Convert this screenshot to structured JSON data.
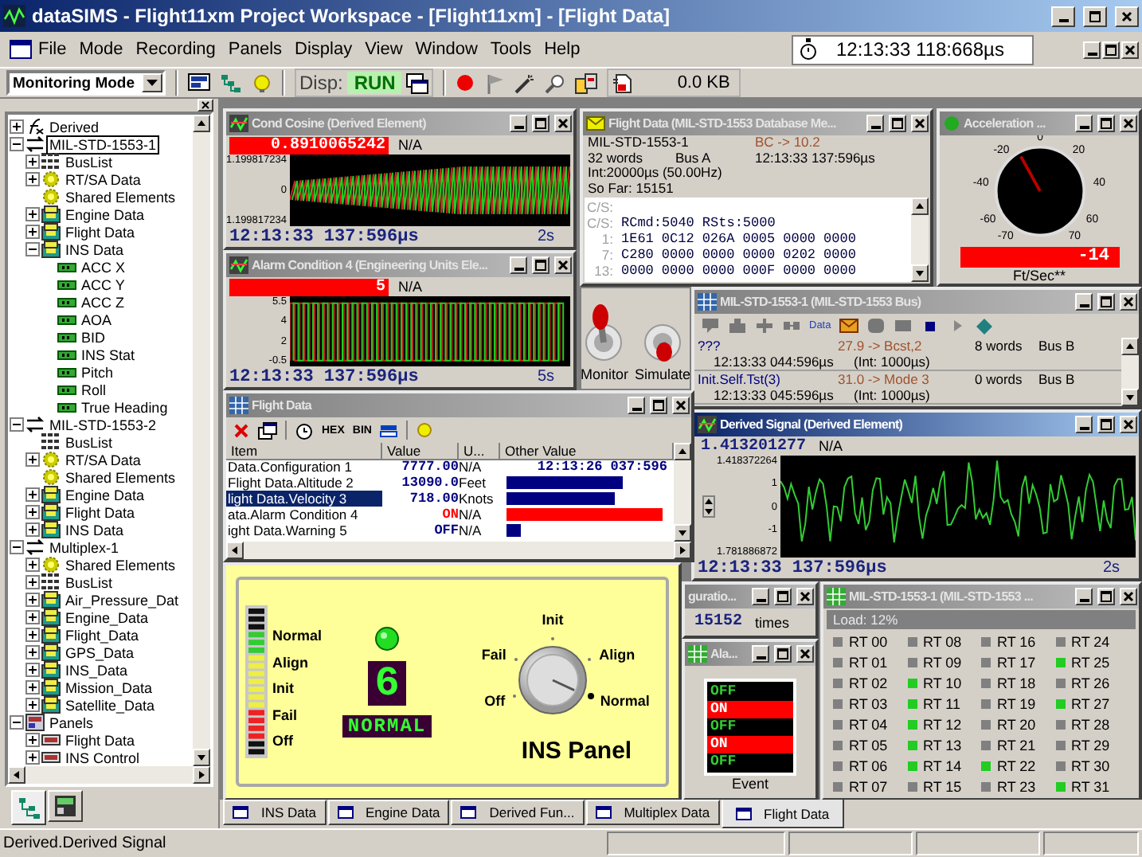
{
  "window": {
    "title": "dataSIMS - Flight11xm Project Workspace - [Flight11xm] - [Flight Data]"
  },
  "menu": [
    "File",
    "Mode",
    "Recording",
    "Panels",
    "Display",
    "View",
    "Window",
    "Tools",
    "Help"
  ],
  "clock": "12:13:33 118:668µs",
  "toolbar": {
    "mode": "Monitoring Mode",
    "disp_label": "Disp:",
    "run": "RUN",
    "size": "0.0 KB"
  },
  "tree": {
    "items": [
      {
        "label": "Derived",
        "kind": "derived",
        "expanded": false,
        "selected": false
      },
      {
        "label": "MIL-STD-1553-1",
        "kind": "bus",
        "expanded": true,
        "selected": true,
        "children": [
          {
            "label": "BusList",
            "kind": "buslist",
            "expanded": false,
            "selected": false
          },
          {
            "label": "RT/SA Data",
            "kind": "rtsa",
            "expanded": false,
            "selected": false
          },
          {
            "label": "Shared Elements",
            "kind": "rtsa",
            "selected": false
          },
          {
            "label": "Engine Data",
            "kind": "data",
            "expanded": false,
            "selected": false
          },
          {
            "label": "Flight Data",
            "kind": "data",
            "expanded": false,
            "selected": false
          },
          {
            "label": "INS Data",
            "kind": "data",
            "expanded": true,
            "selected": false,
            "children": [
              {
                "label": "ACC X",
                "kind": "element",
                "selected": false
              },
              {
                "label": "ACC Y",
                "kind": "element",
                "selected": false
              },
              {
                "label": "ACC Z",
                "kind": "element",
                "selected": false
              },
              {
                "label": "AOA",
                "kind": "element",
                "selected": false
              },
              {
                "label": "BID",
                "kind": "element",
                "selected": false
              },
              {
                "label": "INS Stat",
                "kind": "element",
                "selected": false
              },
              {
                "label": "Pitch",
                "kind": "element",
                "selected": false
              },
              {
                "label": "Roll",
                "kind": "element",
                "selected": false
              },
              {
                "label": "True Heading",
                "kind": "element",
                "selected": false
              }
            ]
          }
        ]
      },
      {
        "label": "MIL-STD-1553-2",
        "kind": "bus",
        "expanded": true,
        "selected": false,
        "children": [
          {
            "label": "BusList",
            "kind": "buslist",
            "selected": false
          },
          {
            "label": "RT/SA Data",
            "kind": "rtsa",
            "expanded": false,
            "selected": false
          },
          {
            "label": "Shared Elements",
            "kind": "rtsa",
            "selected": false
          },
          {
            "label": "Engine Data",
            "kind": "data",
            "expanded": false,
            "selected": false
          },
          {
            "label": "Flight Data",
            "kind": "data",
            "expanded": false,
            "selected": false
          },
          {
            "label": "INS Data",
            "kind": "data",
            "expanded": false,
            "selected": false
          }
        ]
      },
      {
        "label": "Multiplex-1",
        "kind": "bus",
        "expanded": true,
        "selected": false,
        "children": [
          {
            "label": "Shared Elements",
            "kind": "rtsa",
            "expanded": false,
            "selected": false
          },
          {
            "label": "BusList",
            "kind": "buslist",
            "expanded": false,
            "selected": false
          },
          {
            "label": "Air_Pressure_Dat",
            "kind": "data",
            "expanded": false,
            "selected": false
          },
          {
            "label": "Engine_Data",
            "kind": "data",
            "expanded": false,
            "selected": false
          },
          {
            "label": "Flight_Data",
            "kind": "data",
            "expanded": false,
            "selected": false
          },
          {
            "label": "GPS_Data",
            "kind": "data",
            "expanded": false,
            "selected": false
          },
          {
            "label": "INS_Data",
            "kind": "data",
            "expanded": false,
            "selected": false
          },
          {
            "label": "Mission_Data",
            "kind": "data",
            "expanded": false,
            "selected": false
          },
          {
            "label": "Satellite_Data",
            "kind": "data",
            "expanded": false,
            "selected": false
          }
        ]
      },
      {
        "label": "Panels",
        "kind": "panels",
        "expanded": true,
        "selected": false,
        "children": [
          {
            "label": "Flight Data",
            "kind": "panel",
            "expanded": false,
            "selected": false
          },
          {
            "label": "INS Control",
            "kind": "panel",
            "expanded": false,
            "selected": false
          }
        ]
      }
    ]
  },
  "tree_tabs": [
    {
      "kind": "tree",
      "selected": true
    },
    {
      "kind": "panel",
      "selected": false
    }
  ],
  "windows": {
    "cond_cosine": {
      "title": "Cond Cosine (Derived Element)",
      "active": false,
      "value": "0.8910065242",
      "alarm": true,
      "unit": "N/A",
      "kind": "sawtooth",
      "axis_labels": [
        "1.199817234",
        "0",
        "1.199817234"
      ],
      "time": "12:13:33 137:596µs",
      "span": "2s"
    },
    "alarm_scope": {
      "title": "Alarm Condition 4 (Engineering Units Ele...",
      "active": false,
      "value": "5",
      "alarm": true,
      "unit": "N/A",
      "kind": "square",
      "axis_labels": [
        "5.5",
        "4",
        "2",
        "-0.5"
      ],
      "time": "12:13:33 137:596µs",
      "span": "5s"
    },
    "db_view": {
      "title": "Flight Data (MIL-STD-1553 Database Me...",
      "active": false,
      "bus_name": "MIL-STD-1553-1",
      "route": "BC -> 10.2",
      "words": "32 words",
      "bus": "Bus A",
      "time": "12:13:33 137:596µs",
      "interval": "Int:20000µs (50.00Hz)",
      "so_far": "So Far: 15151",
      "rows": [
        {
          "label": "C/S:"
        },
        {
          "label": "C/S:",
          "words": [
            "RCmd:5040",
            "RSts:5000"
          ]
        },
        {
          "label": "1:",
          "words": [
            "1E61",
            "0C12",
            "026A",
            "0005",
            "0000",
            "0000"
          ]
        },
        {
          "label": "7:",
          "words": [
            "C280",
            "0000",
            "0000",
            "0000",
            "0202",
            "0000"
          ]
        },
        {
          "label": "13:",
          "words": [
            "0000",
            "0000",
            "0000",
            "000F",
            "0000",
            "0000"
          ]
        }
      ]
    },
    "gauge": {
      "title": "Acceleration ...",
      "active": false,
      "ticks": [
        "-70",
        "-60",
        "-40",
        "-20",
        "0",
        "20",
        "40",
        "60",
        "70"
      ],
      "level": 0.4,
      "reading": "-14",
      "unit": "Ft/Sec**"
    },
    "toggles": [
      {
        "label": "Monitor",
        "on": true
      },
      {
        "label": "Simulate",
        "on": false
      }
    ],
    "bus_view": {
      "title": "MIL-STD-1553-1 (MIL-STD-1553 Bus)",
      "active": false,
      "tool_label": "Data",
      "messages": [
        {
          "name": "???",
          "route": "27.9 -> Bcst,2",
          "words": "8 words",
          "bus": "Bus B",
          "time": "12:13:33 044:596µs",
          "interval": "(Int: 1000µs)"
        },
        {
          "name": "Init.Self.Tst(3)",
          "route": "31.0 -> Mode 3",
          "words": "0 words",
          "bus": "Bus B",
          "time": "12:13:33 045:596µs",
          "interval": "(Int: 1000µs)"
        }
      ]
    },
    "derived_signal": {
      "title": "Derived Signal (Derived Element)",
      "active": true,
      "value": "1.413201277",
      "alarm": false,
      "unit": "N/A",
      "kind": "random",
      "spinner": true,
      "axis_labels": [
        "1.418372264",
        "1",
        "0",
        "-1",
        "1.781886872"
      ],
      "time": "12:13:33 137:596µs",
      "span": "2s"
    },
    "flight_table": {
      "title": "Flight Data",
      "active": false,
      "tool_labels": [
        "HEX",
        "BIN"
      ],
      "columns": [
        "Item",
        "Value",
        "U...",
        "Other Value"
      ],
      "rows": [
        {
          "item": "Data.Configuration 1",
          "value": "7777.00",
          "unit": "N/A",
          "kind": "text",
          "other": "12:13:26 037:596",
          "color": "#000080",
          "selected": false
        },
        {
          "item": "Flight Data.Altitude 2",
          "value": "13090.0",
          "unit": "Feet",
          "kind": "bar",
          "level": 0.72,
          "color": "#000080",
          "selected": false
        },
        {
          "item": "light Data.Velocity 3",
          "value": "718.00",
          "unit": "Knots",
          "kind": "bar",
          "level": 0.67,
          "color": "#000080",
          "selected": true
        },
        {
          "item": "ata.Alarm Condition 4",
          "value": "ON",
          "unit": "N/A",
          "kind": "bar",
          "level": 0.97,
          "color": "#ff0000",
          "selected": false
        },
        {
          "item": "ight Data.Warning 5",
          "value": "OFF",
          "unit": "N/A",
          "kind": "bar",
          "level": 0.09,
          "color": "#000080",
          "selected": false
        }
      ]
    },
    "ins_panel": {
      "scale": [
        "Normal",
        "Align",
        "Init",
        "Fail",
        "Off"
      ],
      "led_on": true,
      "digit": "6",
      "mode": "NORMAL",
      "knob": [
        {
          "label": "Off",
          "selected": false
        },
        {
          "label": "Fail",
          "selected": false
        },
        {
          "label": "Init",
          "selected": false
        },
        {
          "label": "Align",
          "selected": false
        },
        {
          "label": "Normal",
          "selected": true
        }
      ],
      "title": "INS Panel"
    },
    "counter": {
      "title": "guratio...",
      "active": false,
      "value": "15152",
      "unit": "times"
    },
    "alarm_list": {
      "title": "Ala...",
      "active": false,
      "states": [
        {
          "label": "OFF",
          "on": false
        },
        {
          "label": "ON",
          "on": true
        },
        {
          "label": "OFF",
          "on": false
        },
        {
          "label": "ON",
          "on": true
        },
        {
          "label": "OFF",
          "on": false
        }
      ],
      "caption": "Event"
    },
    "rt_grid": {
      "title": "MIL-STD-1553-1 (MIL-STD-1553 ...",
      "active": false,
      "load": "Load: 12%",
      "terminals": [
        {
          "label": "RT 00",
          "active": false
        },
        {
          "label": "RT 01",
          "active": false
        },
        {
          "label": "RT 02",
          "active": false
        },
        {
          "label": "RT 03",
          "active": false
        },
        {
          "label": "RT 04",
          "active": false
        },
        {
          "label": "RT 05",
          "active": false
        },
        {
          "label": "RT 06",
          "active": false
        },
        {
          "label": "RT 07",
          "active": false
        },
        {
          "label": "RT 08",
          "active": false
        },
        {
          "label": "RT 09",
          "active": false
        },
        {
          "label": "RT 10",
          "active": true
        },
        {
          "label": "RT 11",
          "active": true
        },
        {
          "label": "RT 12",
          "active": true
        },
        {
          "label": "RT 13",
          "active": true
        },
        {
          "label": "RT 14",
          "active": true
        },
        {
          "label": "RT 15",
          "active": false
        },
        {
          "label": "RT 16",
          "active": false
        },
        {
          "label": "RT 17",
          "active": false
        },
        {
          "label": "RT 18",
          "active": false
        },
        {
          "label": "RT 19",
          "active": false
        },
        {
          "label": "RT 20",
          "active": false
        },
        {
          "label": "RT 21",
          "active": false
        },
        {
          "label": "RT 22",
          "active": true
        },
        {
          "label": "RT 23",
          "active": false
        },
        {
          "label": "RT 24",
          "active": false
        },
        {
          "label": "RT 25",
          "active": true
        },
        {
          "label": "RT 26",
          "active": false
        },
        {
          "label": "RT 27",
          "active": true
        },
        {
          "label": "RT 28",
          "active": false
        },
        {
          "label": "RT 29",
          "active": false
        },
        {
          "label": "RT 30",
          "active": false
        },
        {
          "label": "RT 31",
          "active": true
        }
      ]
    }
  },
  "mdi_tabs": [
    {
      "label": "INS Data",
      "selected": false
    },
    {
      "label": "Engine Data",
      "selected": false
    },
    {
      "label": "Derived Fun...",
      "selected": false
    },
    {
      "label": "Multiplex Data",
      "selected": false
    },
    {
      "label": "Flight Data",
      "selected": true
    }
  ],
  "status_bar": "Derived.Derived Signal"
}
